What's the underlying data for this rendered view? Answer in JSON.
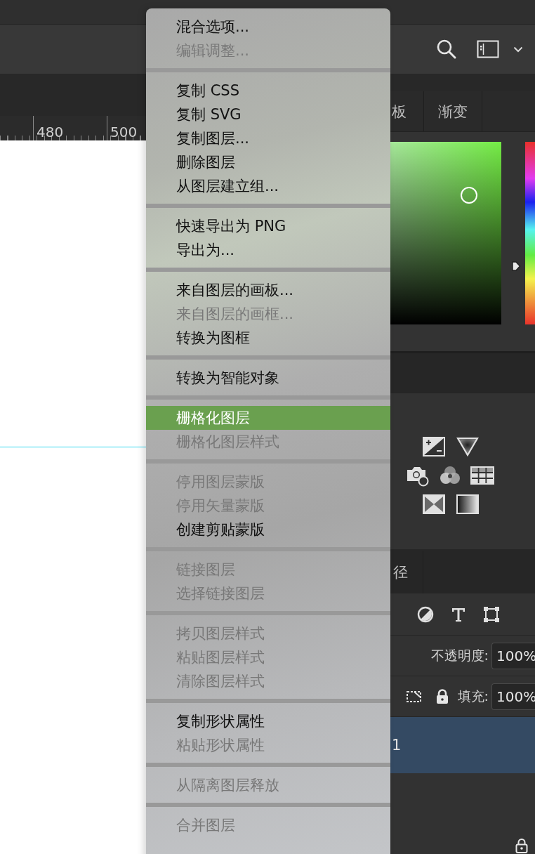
{
  "ruler": {
    "labels": [
      "480",
      "500"
    ]
  },
  "swatch_tabs": [
    {
      "label": "板",
      "selected": false
    },
    {
      "label": "渐变",
      "selected": false
    }
  ],
  "layers_panel": {
    "tabs": [
      {
        "label": "径",
        "selected": false
      }
    ],
    "opacity": {
      "label": "不透明度:",
      "value": "100%"
    },
    "fill": {
      "label": "填充:",
      "value": "100%"
    },
    "layers": [
      {
        "name": "1",
        "selected": true
      }
    ]
  },
  "context_menu": {
    "groups": [
      {
        "items": [
          {
            "label": "混合选项...",
            "disabled": false,
            "selected": false
          },
          {
            "label": "编辑调整...",
            "disabled": true,
            "selected": false
          }
        ]
      },
      {
        "items": [
          {
            "label": "复制 CSS",
            "disabled": false,
            "selected": false
          },
          {
            "label": "复制 SVG",
            "disabled": false,
            "selected": false
          },
          {
            "label": "复制图层...",
            "disabled": false,
            "selected": false
          },
          {
            "label": "删除图层",
            "disabled": false,
            "selected": false
          },
          {
            "label": "从图层建立组...",
            "disabled": false,
            "selected": false
          }
        ]
      },
      {
        "items": [
          {
            "label": "快速导出为 PNG",
            "disabled": false,
            "selected": false
          },
          {
            "label": "导出为...",
            "disabled": false,
            "selected": false
          }
        ]
      },
      {
        "items": [
          {
            "label": "来自图层的画板...",
            "disabled": false,
            "selected": false
          },
          {
            "label": "来自图层的画框...",
            "disabled": true,
            "selected": false
          },
          {
            "label": "转换为图框",
            "disabled": false,
            "selected": false
          }
        ]
      },
      {
        "items": [
          {
            "label": "转换为智能对象",
            "disabled": false,
            "selected": false
          }
        ]
      },
      {
        "items": [
          {
            "label": "栅格化图层",
            "disabled": false,
            "selected": true
          },
          {
            "label": "栅格化图层样式",
            "disabled": true,
            "selected": false
          }
        ]
      },
      {
        "items": [
          {
            "label": "停用图层蒙版",
            "disabled": true,
            "selected": false
          },
          {
            "label": "停用矢量蒙版",
            "disabled": true,
            "selected": false
          },
          {
            "label": "创建剪贴蒙版",
            "disabled": false,
            "selected": false
          }
        ]
      },
      {
        "items": [
          {
            "label": "链接图层",
            "disabled": true,
            "selected": false
          },
          {
            "label": "选择链接图层",
            "disabled": true,
            "selected": false
          }
        ]
      },
      {
        "items": [
          {
            "label": "拷贝图层样式",
            "disabled": true,
            "selected": false
          },
          {
            "label": "粘贴图层样式",
            "disabled": true,
            "selected": false
          },
          {
            "label": "清除图层样式",
            "disabled": true,
            "selected": false
          }
        ]
      },
      {
        "items": [
          {
            "label": "复制形状属性",
            "disabled": false,
            "selected": false
          },
          {
            "label": "粘贴形状属性",
            "disabled": true,
            "selected": false
          }
        ]
      },
      {
        "items": [
          {
            "label": "从隔离图层释放",
            "disabled": true,
            "selected": false
          }
        ]
      },
      {
        "items": [
          {
            "label": "合并图层",
            "disabled": true,
            "selected": false
          }
        ]
      }
    ]
  }
}
